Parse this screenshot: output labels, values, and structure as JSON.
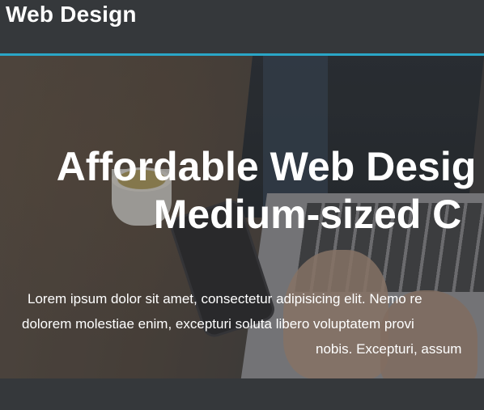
{
  "header": {
    "brand": "Web Design"
  },
  "hero": {
    "title_line1": "Affordable Web Desig",
    "title_line2": "Medium-sized C",
    "text_line1": "Lorem ipsum dolor sit amet, consectetur adipisicing elit. Nemo re",
    "text_line2": "dolorem molestiae enim, excepturi soluta libero voluptatem provi",
    "text_line3": "nobis. Excepturi, assum"
  },
  "colors": {
    "header_bg": "#35383b",
    "accent": "#2aa6c7",
    "text": "#ffffff"
  }
}
